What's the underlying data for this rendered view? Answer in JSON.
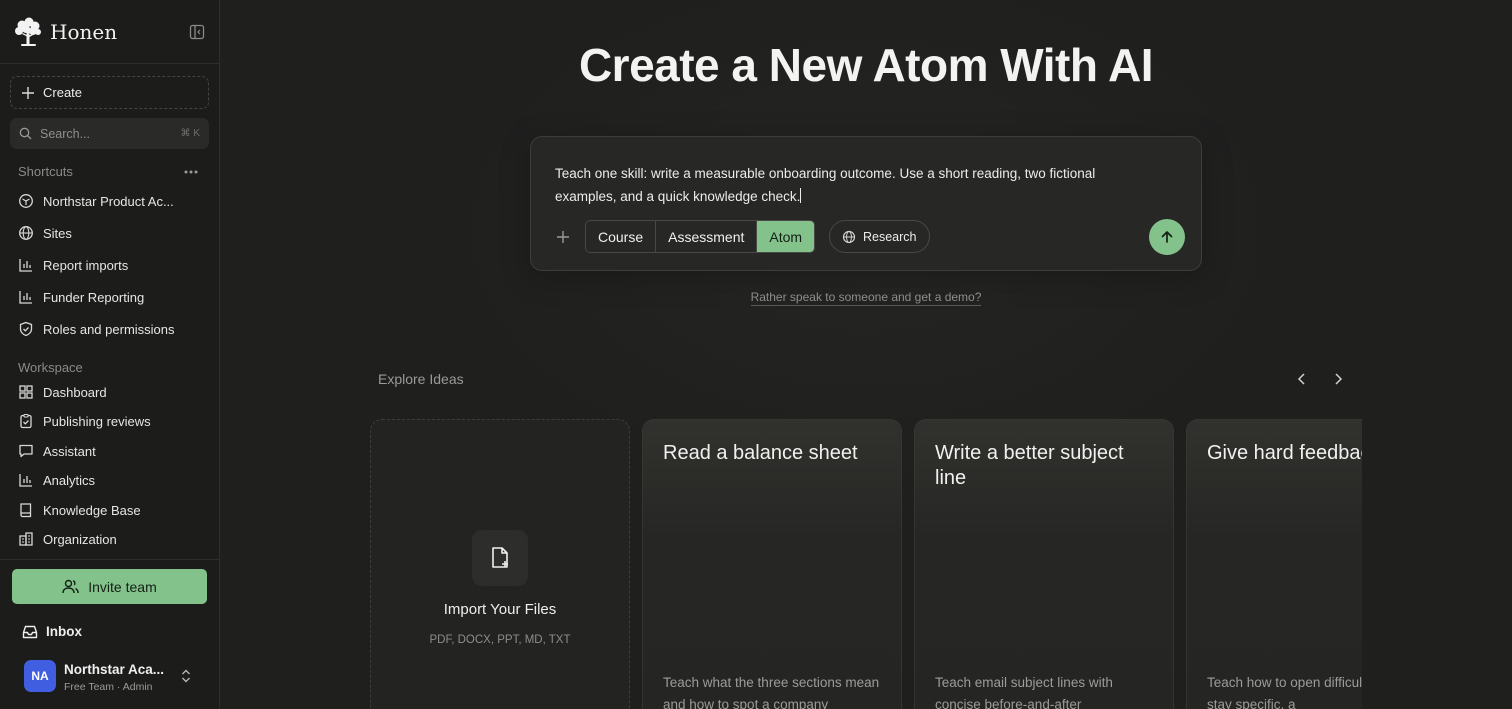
{
  "sidebar": {
    "brand": "Honen",
    "create_label": "Create",
    "search": {
      "placeholder": "Search...",
      "shortcut": "⌘ K"
    },
    "shortcuts_label": "Shortcuts",
    "shortcuts": [
      {
        "label": "Northstar Product Ac...",
        "icon": "box-icon"
      },
      {
        "label": "Sites",
        "icon": "globe-icon"
      },
      {
        "label": "Report imports",
        "icon": "bar-chart-icon"
      },
      {
        "label": "Funder Reporting",
        "icon": "bar-chart-icon"
      },
      {
        "label": "Roles and permissions",
        "icon": "shield-check-icon"
      }
    ],
    "workspace_label": "Workspace",
    "workspace": [
      {
        "label": "Dashboard",
        "icon": "grid-icon"
      },
      {
        "label": "Publishing reviews",
        "icon": "clipboard-check-icon"
      },
      {
        "label": "Assistant",
        "icon": "chat-icon"
      },
      {
        "label": "Analytics",
        "icon": "bar-chart-icon"
      },
      {
        "label": "Knowledge Base",
        "icon": "book-icon"
      },
      {
        "label": "Organization",
        "icon": "building-icon"
      }
    ],
    "invite_label": "Invite team",
    "inbox_label": "Inbox",
    "account": {
      "initials": "NA",
      "name": "Northstar Aca...",
      "plan": "Free Team · Admin",
      "avatar_color": "#3f5fe0"
    }
  },
  "main": {
    "title": "Create a New Atom With AI",
    "prompt": "Teach one skill: write a measurable onboarding outcome. Use a short reading, two fictional examples, and a quick knowledge check.",
    "modes": [
      "Course",
      "Assessment",
      "Atom"
    ],
    "active_mode": "Atom",
    "research_label": "Research",
    "demo_link": "Rather speak to someone and get a demo?",
    "explore_label": "Explore Ideas",
    "import_card": {
      "title": "Import Your Files",
      "formats": "PDF, DOCX, PPT, MD, TXT"
    },
    "idea_cards": [
      {
        "title": "Read a balance sheet",
        "desc": "Teach what the three sections mean and how to spot a company"
      },
      {
        "title": "Write a better subject line",
        "desc": "Teach email subject lines with concise before-and-after"
      },
      {
        "title": "Give hard feedback",
        "desc": "Teach how to open difficult feedback, stay specific, a"
      }
    ]
  },
  "colors": {
    "accent": "#84c28c",
    "background": "#1f1f1e",
    "avatar": "#3f5fe0"
  }
}
